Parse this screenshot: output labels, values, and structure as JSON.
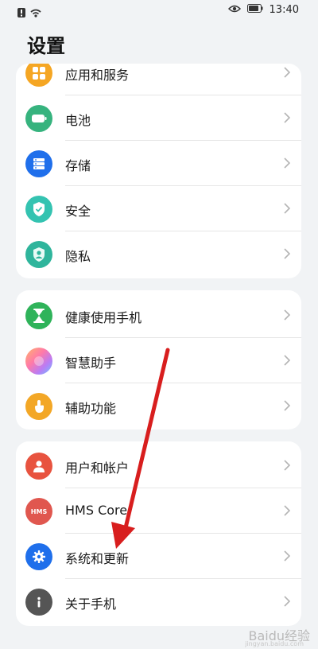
{
  "status_bar": {
    "time": "13:40"
  },
  "page": {
    "title": "设置"
  },
  "groups": [
    {
      "items": [
        {
          "label": "应用和服务",
          "icon": "apps-icon",
          "color": "#f5a623"
        },
        {
          "label": "电池",
          "icon": "battery-icon",
          "color": "#36b37e"
        },
        {
          "label": "存储",
          "icon": "storage-icon",
          "color": "#1f6feb"
        },
        {
          "label": "安全",
          "icon": "shield-icon",
          "color": "#34c3b1"
        },
        {
          "label": "隐私",
          "icon": "privacy-icon",
          "color": "#2fb59c"
        }
      ]
    },
    {
      "items": [
        {
          "label": "健康使用手机",
          "icon": "hourglass-icon",
          "color": "#2fb35a"
        },
        {
          "label": "智慧助手",
          "icon": "assistant-icon",
          "color": "#c57cf0"
        },
        {
          "label": "辅助功能",
          "icon": "touch-icon",
          "color": "#f3a726"
        }
      ]
    },
    {
      "items": [
        {
          "label": "用户和帐户",
          "icon": "user-icon",
          "color": "#e8533f"
        },
        {
          "label": "HMS Core",
          "icon": "hms-icon",
          "icon_text": "HMS",
          "color": "#e0574f"
        },
        {
          "label": "系统和更新",
          "icon": "gear-icon",
          "color": "#1f6feb"
        },
        {
          "label": "关于手机",
          "icon": "info-icon",
          "color": "#555555"
        }
      ]
    }
  ],
  "watermark": {
    "text": "Baidu经验",
    "sub": "jingyan.baidu.com"
  }
}
